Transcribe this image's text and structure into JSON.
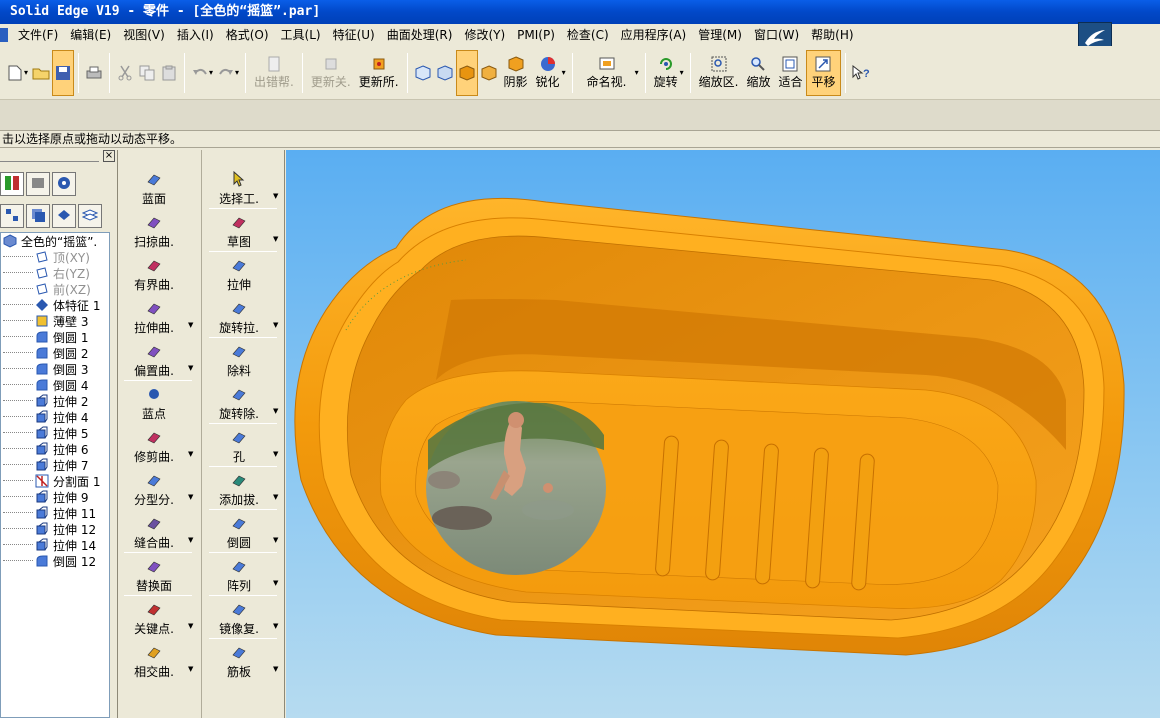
{
  "window": {
    "title": "Solid Edge V19 - 零件 - [全色的“摇篮”.par]"
  },
  "menu": {
    "items": [
      "文件(F)",
      "编辑(E)",
      "视图(V)",
      "插入(I)",
      "格式(O)",
      "工具(L)",
      "特征(U)",
      "曲面处理(R)",
      "修改(Y)",
      "PMI(P)",
      "检查(C)",
      "应用程序(A)",
      "管理(M)",
      "窗口(W)",
      "帮助(H)"
    ]
  },
  "toolbar": {
    "error_help": "出错帮.",
    "update_related": "更新关.",
    "update_all": "更新所.",
    "shading": "阴影",
    "sharpen": "锐化",
    "named_view": "命名视.",
    "rotate": "旋转",
    "zoom_area": "缩放区.",
    "zoom": "缩放",
    "fit": "适合",
    "pan": "平移"
  },
  "prompt": {
    "text": "击以选择原点或拖动以动态平移。"
  },
  "tree": {
    "close": "×",
    "items": [
      {
        "label": "全色的“摇篮”.",
        "icon": "part-icon",
        "style": "root"
      },
      {
        "label": "顶(XY)",
        "icon": "plane-icon",
        "style": "grey"
      },
      {
        "label": "右(YZ)",
        "icon": "plane-icon",
        "style": "grey"
      },
      {
        "label": "前(XZ)",
        "icon": "plane-icon",
        "style": "grey"
      },
      {
        "label": "体特征 1",
        "icon": "body-feature-icon",
        "style": "normal"
      },
      {
        "label": "薄壁 3",
        "icon": "thin-wall-icon",
        "style": "normal"
      },
      {
        "label": "倒圆 1",
        "icon": "round-icon",
        "style": "normal"
      },
      {
        "label": "倒圆 2",
        "icon": "round-icon",
        "style": "normal"
      },
      {
        "label": "倒圆 3",
        "icon": "round-icon",
        "style": "normal"
      },
      {
        "label": "倒圆 4",
        "icon": "round-icon",
        "style": "normal"
      },
      {
        "label": "拉伸 2",
        "icon": "extrude-icon",
        "style": "normal"
      },
      {
        "label": "拉伸 4",
        "icon": "extrude-icon",
        "style": "normal"
      },
      {
        "label": "拉伸 5",
        "icon": "extrude-icon",
        "style": "normal"
      },
      {
        "label": "拉伸 6",
        "icon": "extrude-icon",
        "style": "normal"
      },
      {
        "label": "拉伸 7",
        "icon": "extrude-icon",
        "style": "normal"
      },
      {
        "label": "分割面 1",
        "icon": "split-face-icon",
        "style": "normal"
      },
      {
        "label": "拉伸 9",
        "icon": "extrude-icon",
        "style": "normal"
      },
      {
        "label": "拉伸 11",
        "icon": "extrude-icon",
        "style": "normal"
      },
      {
        "label": "拉伸 12",
        "icon": "extrude-icon",
        "style": "normal"
      },
      {
        "label": "拉伸 14",
        "icon": "extrude-icon",
        "style": "normal"
      },
      {
        "label": "倒圆 12",
        "icon": "round-icon",
        "style": "normal"
      }
    ]
  },
  "surface_commands": [
    {
      "label": "蓝面",
      "icon": "blue-surface-icon",
      "dropdown": false
    },
    {
      "label": "扫掠曲.",
      "icon": "swept-surface-icon",
      "dropdown": false
    },
    {
      "label": "有界曲.",
      "icon": "bounded-surface-icon",
      "dropdown": false
    },
    {
      "label": "拉伸曲.",
      "icon": "extruded-surface-icon",
      "dropdown": true
    },
    {
      "label": "偏置曲.",
      "icon": "offset-surface-icon",
      "dropdown": true
    },
    {
      "label": "蓝点",
      "icon": "blue-dot-icon",
      "dropdown": false
    },
    {
      "label": "修剪曲.",
      "icon": "trim-surface-icon",
      "dropdown": true
    },
    {
      "label": "分型分.",
      "icon": "parting-split-icon",
      "dropdown": true
    },
    {
      "label": "缝合曲.",
      "icon": "stitch-surface-icon",
      "dropdown": true
    },
    {
      "label": "替换面",
      "icon": "replace-face-icon",
      "dropdown": false
    },
    {
      "label": "关键点.",
      "icon": "keypoint-curve-icon",
      "dropdown": true
    },
    {
      "label": "相交曲.",
      "icon": "intersection-curve-icon",
      "dropdown": true
    }
  ],
  "feature_commands": [
    {
      "label": "选择工.",
      "icon": "select-tool-icon",
      "dropdown": true
    },
    {
      "label": "草图",
      "icon": "sketch-icon",
      "dropdown": true
    },
    {
      "label": "拉伸",
      "icon": "extrude-icon",
      "dropdown": false
    },
    {
      "label": "旋转拉.",
      "icon": "revolve-icon",
      "dropdown": true
    },
    {
      "label": "除料",
      "icon": "cutout-icon",
      "dropdown": false
    },
    {
      "label": "旋转除.",
      "icon": "revolved-cutout-icon",
      "dropdown": true
    },
    {
      "label": "孔",
      "icon": "hole-icon",
      "dropdown": true
    },
    {
      "label": "添加拔.",
      "icon": "add-draft-icon",
      "dropdown": true
    },
    {
      "label": "倒圆",
      "icon": "round-icon",
      "dropdown": true
    },
    {
      "label": "阵列",
      "icon": "pattern-icon",
      "dropdown": true
    },
    {
      "label": "镜像复.",
      "icon": "mirror-copy-icon",
      "dropdown": true
    },
    {
      "label": "筋板",
      "icon": "rib-icon",
      "dropdown": true
    }
  ],
  "colors": {
    "model": "#f59a0a",
    "viewport_top": "#5aaef2",
    "titlebar": "#0148c8",
    "active_button": "#ffd27a"
  }
}
